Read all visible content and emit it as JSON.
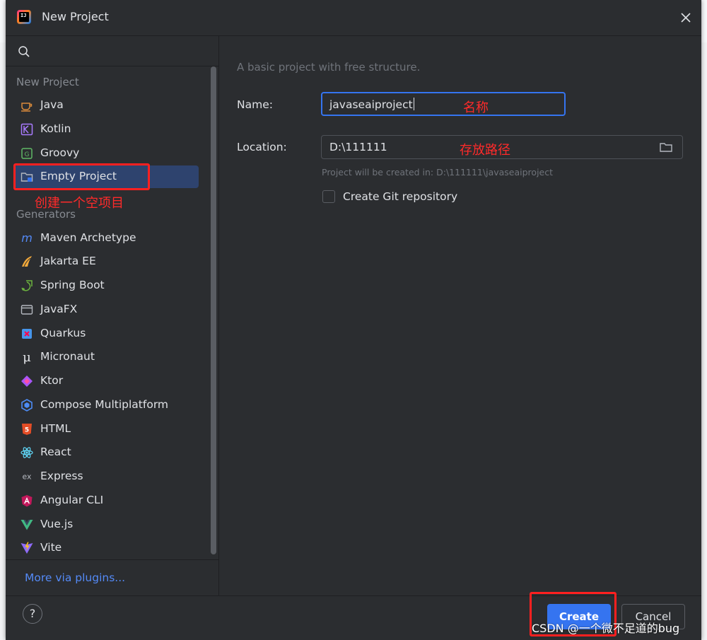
{
  "window": {
    "title": "New Project"
  },
  "sidebar": {
    "search_icon": "search-icon",
    "group_new_project": "New Project",
    "new_project_items": [
      {
        "label": "Java",
        "icon": "java-icon"
      },
      {
        "label": "Kotlin",
        "icon": "kotlin-icon"
      },
      {
        "label": "Groovy",
        "icon": "groovy-icon"
      },
      {
        "label": "Empty Project",
        "icon": "empty-project-icon",
        "selected": true
      }
    ],
    "group_generators": "Generators",
    "generator_items": [
      {
        "label": "Maven Archetype",
        "icon": "maven-icon"
      },
      {
        "label": "Jakarta EE",
        "icon": "jakarta-ee-icon"
      },
      {
        "label": "Spring Boot",
        "icon": "spring-boot-icon"
      },
      {
        "label": "JavaFX",
        "icon": "javafx-icon"
      },
      {
        "label": "Quarkus",
        "icon": "quarkus-icon"
      },
      {
        "label": "Micronaut",
        "icon": "micronaut-icon"
      },
      {
        "label": "Ktor",
        "icon": "ktor-icon"
      },
      {
        "label": "Compose Multiplatform",
        "icon": "compose-icon"
      },
      {
        "label": "HTML",
        "icon": "html5-icon"
      },
      {
        "label": "React",
        "icon": "react-icon"
      },
      {
        "label": "Express",
        "icon": "express-icon"
      },
      {
        "label": "Angular CLI",
        "icon": "angular-icon"
      },
      {
        "label": "Vue.js",
        "icon": "vue-icon"
      },
      {
        "label": "Vite",
        "icon": "vite-icon"
      }
    ],
    "more_link": "More via plugins..."
  },
  "main": {
    "description": "A basic project with free structure.",
    "name_label": "Name:",
    "name_value": "javaseaiproject",
    "location_label": "Location:",
    "location_value": "D:\\111111",
    "location_hint": "Project will be created in: D:\\111111\\javaseaiproject",
    "git_checkbox_label": "Create Git repository",
    "git_checkbox_checked": false
  },
  "footer": {
    "help_label": "?",
    "create_label": "Create",
    "cancel_label": "Cancel"
  },
  "annotations": {
    "empty_project": "创建一个空项目",
    "name": "名称",
    "location": "存放路径"
  },
  "watermark": "CSDN @一个微不足道的bug",
  "colors": {
    "background": "#2b2d30",
    "accent": "#3574f0",
    "selection": "#2e436e",
    "link": "#548af7",
    "annotation": "#ff2020"
  }
}
